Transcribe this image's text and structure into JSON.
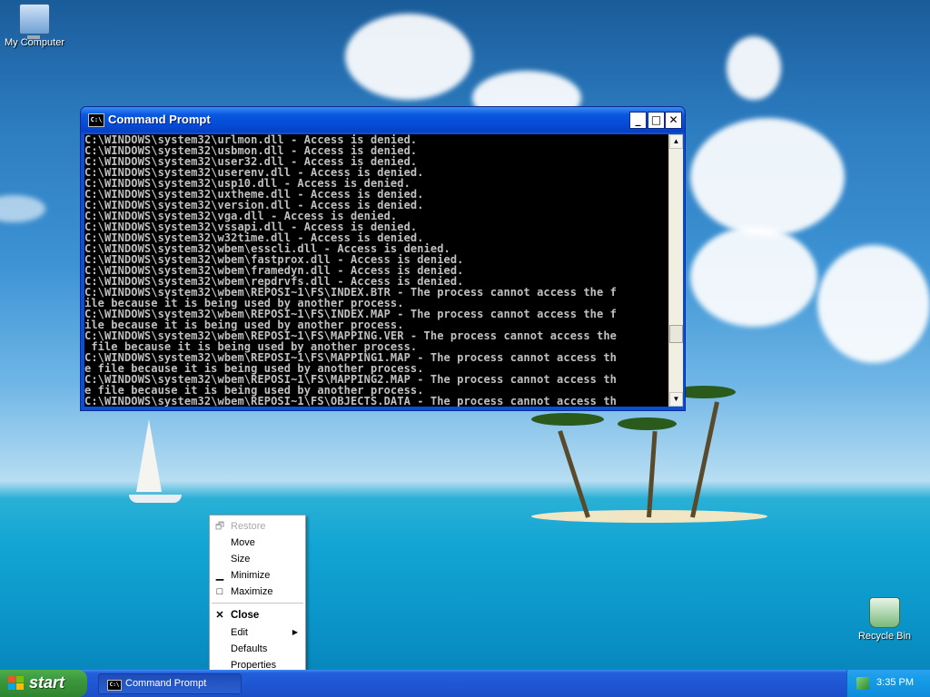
{
  "desktop": {
    "icons": [
      {
        "label": "My Computer"
      },
      {
        "label": "Recycle Bin"
      }
    ]
  },
  "window": {
    "title": "Command Prompt",
    "icon_text": "C:\\",
    "buttons": {
      "minimize": "_",
      "maximize": "□",
      "close": "✕"
    },
    "console_lines": [
      "C:\\WINDOWS\\system32\\urlmon.dll - Access is denied.",
      "C:\\WINDOWS\\system32\\usbmon.dll - Access is denied.",
      "C:\\WINDOWS\\system32\\user32.dll - Access is denied.",
      "C:\\WINDOWS\\system32\\userenv.dll - Access is denied.",
      "C:\\WINDOWS\\system32\\usp10.dll - Access is denied.",
      "C:\\WINDOWS\\system32\\uxtheme.dll - Access is denied.",
      "C:\\WINDOWS\\system32\\version.dll - Access is denied.",
      "C:\\WINDOWS\\system32\\vga.dll - Access is denied.",
      "C:\\WINDOWS\\system32\\vssapi.dll - Access is denied.",
      "C:\\WINDOWS\\system32\\w32time.dll - Access is denied.",
      "C:\\WINDOWS\\system32\\wbem\\esscli.dll - Access is denied.",
      "C:\\WINDOWS\\system32\\wbem\\fastprox.dll - Access is denied.",
      "C:\\WINDOWS\\system32\\wbem\\framedyn.dll - Access is denied.",
      "C:\\WINDOWS\\system32\\wbem\\repdrvfs.dll - Access is denied.",
      "C:\\WINDOWS\\system32\\wbem\\REPOSI~1\\FS\\INDEX.BTR - The process cannot access the f",
      "ile because it is being used by another process.",
      "C:\\WINDOWS\\system32\\wbem\\REPOSI~1\\FS\\INDEX.MAP - The process cannot access the f",
      "ile because it is being used by another process.",
      "C:\\WINDOWS\\system32\\wbem\\REPOSI~1\\FS\\MAPPING.VER - The process cannot access the",
      " file because it is being used by another process.",
      "C:\\WINDOWS\\system32\\wbem\\REPOSI~1\\FS\\MAPPING1.MAP - The process cannot access th",
      "e file because it is being used by another process.",
      "C:\\WINDOWS\\system32\\wbem\\REPOSI~1\\FS\\MAPPING2.MAP - The process cannot access th",
      "e file because it is being used by another process.",
      "C:\\WINDOWS\\system32\\wbem\\REPOSI~1\\FS\\OBJECTS.DATA - The process cannot access th"
    ]
  },
  "system_menu": {
    "items": [
      {
        "label": "Restore",
        "icon": "restore-icon",
        "glyph": "🗗",
        "enabled": false
      },
      {
        "label": "Move",
        "enabled": true
      },
      {
        "label": "Size",
        "enabled": true
      },
      {
        "label": "Minimize",
        "icon": "minimize-icon",
        "glyph": "▁",
        "enabled": true
      },
      {
        "label": "Maximize",
        "icon": "maximize-icon",
        "glyph": "□",
        "enabled": true
      },
      {
        "label": "Close",
        "icon": "close-icon",
        "glyph": "✕",
        "enabled": true,
        "bold": true
      },
      {
        "label": "Edit",
        "submenu": true,
        "enabled": true
      },
      {
        "label": "Defaults",
        "enabled": true
      },
      {
        "label": "Properties",
        "enabled": true
      }
    ]
  },
  "taskbar": {
    "start_label": "start",
    "task_label": "Command Prompt",
    "clock": "3:35 PM"
  },
  "colors": {
    "console_bg": "#000000",
    "console_text": "#c0c0c0",
    "title_blue": "#0a58e0",
    "start_green": "#3c963c",
    "tray_blue": "#149be6"
  }
}
